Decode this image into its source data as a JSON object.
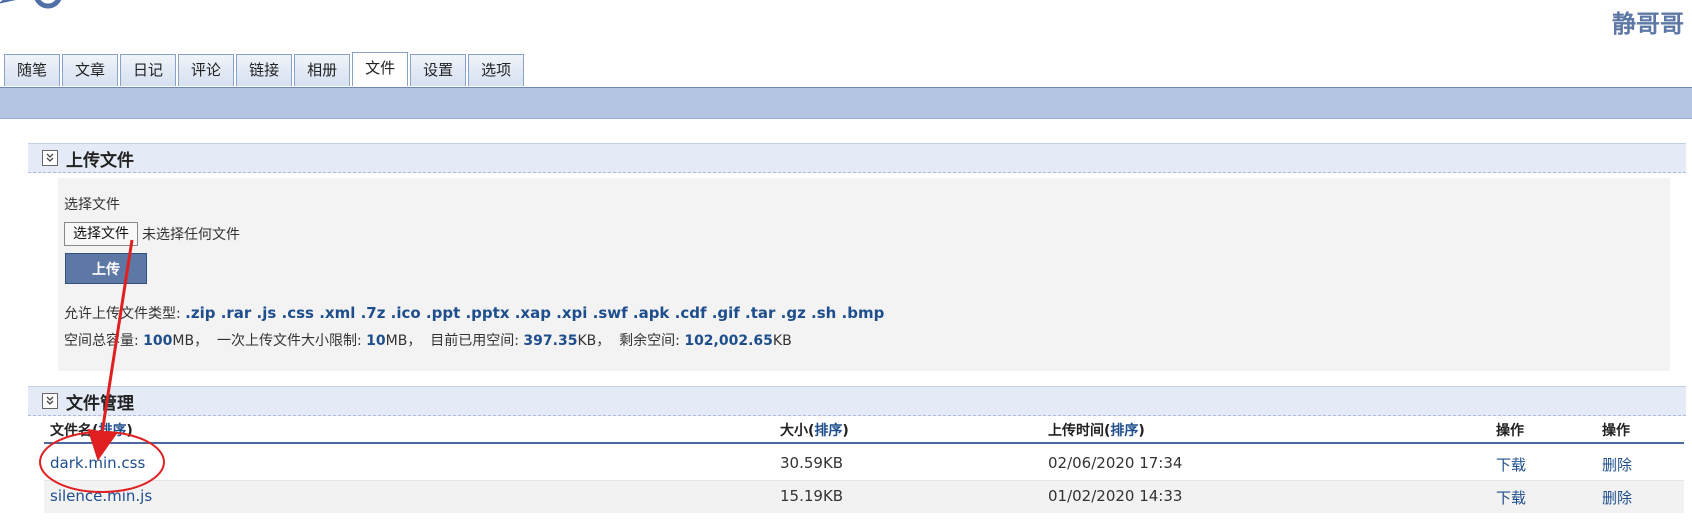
{
  "header": {
    "site_name": "静哥哥"
  },
  "tabs": [
    {
      "label": "随笔"
    },
    {
      "label": "文章"
    },
    {
      "label": "日记"
    },
    {
      "label": "评论"
    },
    {
      "label": "链接"
    },
    {
      "label": "相册"
    },
    {
      "label": "文件",
      "active": true
    },
    {
      "label": "设置"
    },
    {
      "label": "选项"
    }
  ],
  "upload": {
    "section_title": "上传文件",
    "select_label": "选择文件",
    "choose_button": "选择文件",
    "no_file_text": "未选择任何文件",
    "upload_button": "上传",
    "allowed_prefix": "允许上传文件类型:",
    "allowed_types": ".zip .rar .js .css .xml .7z .ico .ppt .pptx .xap .xpi .swf .apk .cdf .gif .tar .gz .sh .bmp",
    "quota": {
      "total_label": "空间总容量:",
      "total_value": "100",
      "total_unit": "MB，",
      "single_label": "一次上传文件大小限制:",
      "single_value": "10",
      "single_unit": "MB，",
      "used_label": "目前已用空间:",
      "used_value": "397.35",
      "used_unit": "KB，",
      "remaining_label": "剩余空间:",
      "remaining_value": "102,002.65",
      "remaining_unit": "KB"
    }
  },
  "files": {
    "section_title": "文件管理",
    "columns": {
      "name": "文件名(",
      "size": "大小(",
      "time": "上传时间(",
      "sort": "排序",
      "close": ")",
      "action": "操作"
    },
    "rows": [
      {
        "name": "dark.min.css",
        "size": "30.59KB",
        "time": "02/06/2020 17:34",
        "download": "下载",
        "delete": "删除"
      },
      {
        "name": "silence.min.js",
        "size": "15.19KB",
        "time": "01/02/2020 14:33",
        "download": "下载",
        "delete": "删除"
      }
    ]
  },
  "colors": {
    "accent": "#5e78a6",
    "link": "#1f4e8c",
    "tab_bar": "#b4c5e4",
    "annotation": "#e02020"
  }
}
